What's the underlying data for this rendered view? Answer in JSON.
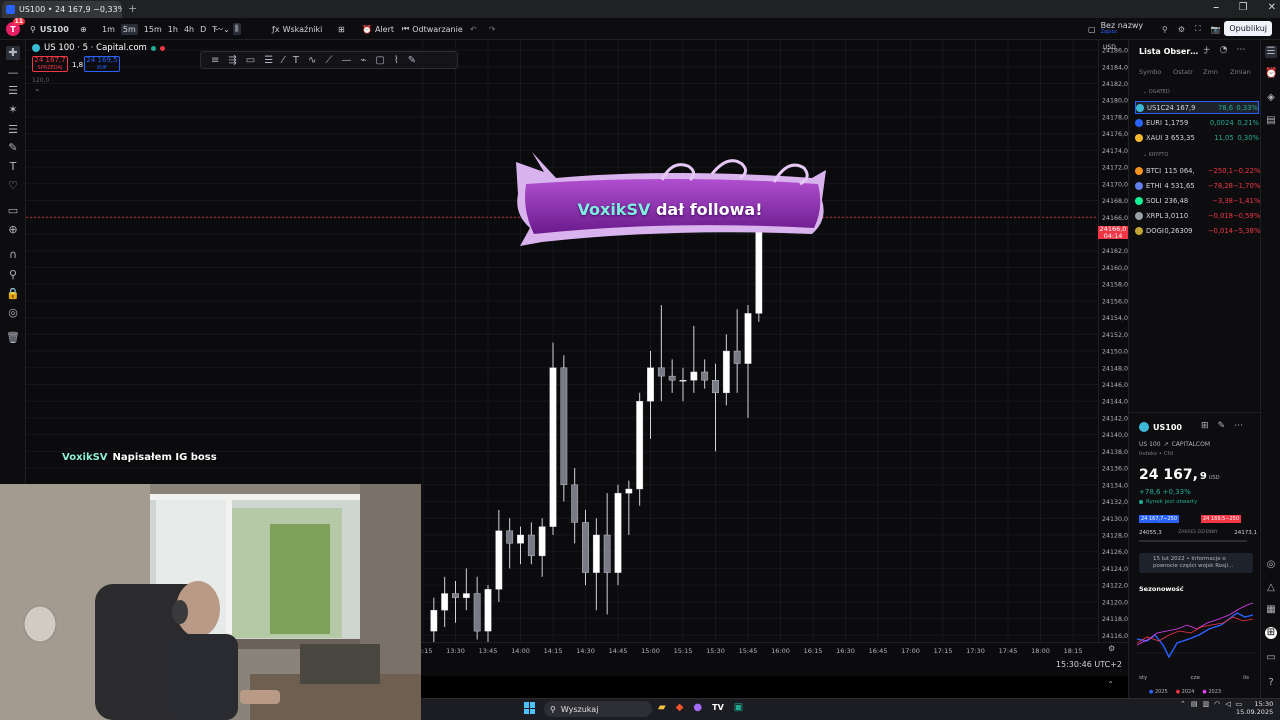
{
  "browser": {
    "tab_title": "US100 • 24 167,9 −0,33% / Bez…",
    "new_tab": "+",
    "window_controls": [
      "⎯",
      "❐",
      "✕"
    ]
  },
  "toolbar": {
    "logo_badge": "11",
    "symbol": "US100",
    "timeframes": [
      "1m",
      "5m",
      "15m",
      "1h",
      "4h",
      "D",
      "T"
    ],
    "selected_timeframe": "5m",
    "indicators_label": "Wskaźniki",
    "alert_label": "Alert",
    "replay_label": "Odtwarzanie",
    "layout_name": "Bez nazwy",
    "layout_sub": "Zapisz",
    "publish_label": "Opublikuj"
  },
  "chart": {
    "legend_title": "US 100 · 5 · Capital.com",
    "bid_price": "24 167,7",
    "bid_label": "SPRZEDAJ",
    "spread": "1,8",
    "ask_price": "24 169,5",
    "ask_label": "KUP",
    "small_label": "120,0"
  },
  "chart_data": {
    "type": "candlestick",
    "y_ticks": [
      "24186,0",
      "24184,0",
      "24182,0",
      "24180,0",
      "24178,0",
      "24176,0",
      "24174,0",
      "24172,0",
      "24170,0",
      "24168,0",
      "24166,0",
      "24164,0",
      "24162,0",
      "24160,0",
      "24158,0",
      "24156,0",
      "24154,0",
      "24152,0",
      "24150,0",
      "24148,0",
      "24146,0",
      "24144,0",
      "24142,0",
      "24140,0",
      "24138,0",
      "24136,0",
      "24134,0",
      "24132,0",
      "24130,0",
      "24128,0",
      "24126,0",
      "24124,0",
      "24122,0",
      "24120,0",
      "24118,0",
      "24116,0"
    ],
    "ylim": [
      24115.2,
      24187.2
    ],
    "x_ticks": [
      "13:15",
      "13:30",
      "13:45",
      "14:00",
      "14:15",
      "14:30",
      "14:45",
      "15:00",
      "15:15",
      "15:30",
      "15:45",
      "16:00",
      "16:15",
      "16:30",
      "16:45",
      "17:00",
      "17:15",
      "17:30",
      "17:45",
      "18:00",
      "18:15"
    ],
    "current_price": "24166,0",
    "current_price_timer": "04:14",
    "current_price_value": 24166.0,
    "currency": "USD",
    "candles": [
      {
        "o": 24116.5,
        "h": 24120.5,
        "l": 24115.0,
        "c": 24119.0
      },
      {
        "o": 24119.0,
        "h": 24123.0,
        "l": 24117.0,
        "c": 24121.0
      },
      {
        "o": 24121.0,
        "h": 24122.5,
        "l": 24117.5,
        "c": 24120.5
      },
      {
        "o": 24120.5,
        "h": 24124.0,
        "l": 24119.0,
        "c": 24121.0
      },
      {
        "o": 24121.0,
        "h": 24123.0,
        "l": 24115.5,
        "c": 24116.5
      },
      {
        "o": 24116.5,
        "h": 24122.0,
        "l": 24115.0,
        "c": 24121.5
      },
      {
        "o": 24121.5,
        "h": 24131.0,
        "l": 24120.0,
        "c": 24128.5
      },
      {
        "o": 24128.5,
        "h": 24130.0,
        "l": 24124.0,
        "c": 24127.0
      },
      {
        "o": 24127.0,
        "h": 24129.0,
        "l": 24124.5,
        "c": 24128.0
      },
      {
        "o": 24128.0,
        "h": 24129.5,
        "l": 24124.5,
        "c": 24125.5
      },
      {
        "o": 24125.5,
        "h": 24130.0,
        "l": 24123.0,
        "c": 24129.0
      },
      {
        "o": 24129.0,
        "h": 24151.0,
        "l": 24128.0,
        "c": 24148.0
      },
      {
        "o": 24148.0,
        "h": 24149.5,
        "l": 24132.0,
        "c": 24134.0
      },
      {
        "o": 24134.0,
        "h": 24136.0,
        "l": 24127.0,
        "c": 24129.5
      },
      {
        "o": 24129.5,
        "h": 24131.0,
        "l": 24122.0,
        "c": 24123.5
      },
      {
        "o": 24123.5,
        "h": 24130.0,
        "l": 24119.0,
        "c": 24128.0
      },
      {
        "o": 24128.0,
        "h": 24133.0,
        "l": 24118.5,
        "c": 24123.5
      },
      {
        "o": 24123.5,
        "h": 24134.0,
        "l": 24122.0,
        "c": 24133.0
      },
      {
        "o": 24133.0,
        "h": 24134.5,
        "l": 24128.0,
        "c": 24133.5
      },
      {
        "o": 24133.5,
        "h": 24145.0,
        "l": 24131.5,
        "c": 24144.0
      },
      {
        "o": 24144.0,
        "h": 24150.0,
        "l": 24139.5,
        "c": 24148.0
      },
      {
        "o": 24148.0,
        "h": 24155.5,
        "l": 24144.0,
        "c": 24147.0
      },
      {
        "o": 24147.0,
        "h": 24149.0,
        "l": 24145.0,
        "c": 24146.5
      },
      {
        "o": 24146.5,
        "h": 24148.0,
        "l": 24144.0,
        "c": 24146.5
      },
      {
        "o": 24146.5,
        "h": 24153.0,
        "l": 24145.0,
        "c": 24147.5
      },
      {
        "o": 24147.5,
        "h": 24149.0,
        "l": 24145.5,
        "c": 24146.5
      },
      {
        "o": 24146.5,
        "h": 24148.5,
        "l": 24138.0,
        "c": 24145.0
      },
      {
        "o": 24145.0,
        "h": 24152.0,
        "l": 24143.5,
        "c": 24150.0
      },
      {
        "o": 24150.0,
        "h": 24155.0,
        "l": 24145.0,
        "c": 24148.5
      },
      {
        "o": 24148.5,
        "h": 24155.5,
        "l": 24142.0,
        "c": 24154.5
      },
      {
        "o": 24154.5,
        "h": 24167.0,
        "l": 24153.5,
        "c": 24166.0
      }
    ],
    "up_color": "#ffffff",
    "down_color": "#787b86",
    "grid": true
  },
  "drawing_tools": [
    "≡",
    "⇶",
    "▭",
    "☰",
    "⁄",
    "T",
    "∿",
    "⟋",
    "—",
    "⌁",
    "▢",
    "⌇",
    "✎"
  ],
  "left_tools": [
    "✚",
    "—",
    "☰",
    "✶",
    "☰",
    "✎",
    "T",
    "♡",
    "▭",
    "⊕",
    "∩",
    "⚲",
    "🔒",
    "◎",
    "🗑"
  ],
  "watchlist": {
    "title": "Lista Obser…",
    "columns": [
      "Symbo",
      "Ostatr",
      "Zmn",
      "Zmian"
    ],
    "section1": "OGATED",
    "section2": "KRYPTO",
    "rows": [
      {
        "sym": "US1C",
        "last": "24 167,9",
        "chg": "78,6",
        "pct": "0,33%",
        "dir": "up",
        "color": "#3bb9d6"
      },
      {
        "sym": "EURI",
        "last": "1,1759",
        "chg": "0,0024",
        "pct": "0,21%",
        "dir": "up",
        "color": "#2962ff"
      },
      {
        "sym": "XAUI",
        "last": "3 653,35",
        "chg": "11,05",
        "pct": "0,30%",
        "dir": "up",
        "color": "#f5b82e"
      },
      {
        "sym": "BTCI",
        "last": "115 064,",
        "chg": "−250,1",
        "pct": "−0,22%",
        "dir": "dn",
        "color": "#f7931a"
      },
      {
        "sym": "ETHI",
        "last": "4 531,65",
        "chg": "−78,28",
        "pct": "−1,70%",
        "dir": "dn",
        "color": "#627eea"
      },
      {
        "sym": "SOLI",
        "last": "236,48",
        "chg": "−3,38",
        "pct": "−1,41%",
        "dir": "dn",
        "color": "#14f195"
      },
      {
        "sym": "XRPL",
        "last": "3,0110",
        "chg": "−0,018",
        "pct": "−0,59%",
        "dir": "dn",
        "color": "#9aa0a6"
      },
      {
        "sym": "DOGI",
        "last": "0,26309",
        "chg": "−0,014",
        "pct": "−5,38%",
        "dir": "dn",
        "color": "#c2a633"
      }
    ]
  },
  "details": {
    "symbol": "US100",
    "name": "US 100",
    "exchange": "CAPITALCOM",
    "type": "Indeks • Cfd",
    "price_main": "24 167,",
    "price_last": "9",
    "currency": "USD",
    "change": "+78,6 +0,33%",
    "market_status": "Rynek jest otwarty",
    "bid": "24 167,7−250",
    "ask": "24 169,5−250",
    "range_low": "24055,3",
    "range_label": "ZAKRES DZIENNY",
    "range_high": "24173,1",
    "news_date": "15 lut 2022",
    "news_text": "Informacje o powrocie części wojsk Rosji…",
    "seasonal_title": "Sezonowość",
    "seasonal_x": [
      "sty",
      "cze",
      "lis"
    ],
    "seasonal_legend": [
      "2025",
      "2024",
      "2023"
    ]
  },
  "right_strip": [
    "☰",
    "⏰",
    "◈",
    "▤",
    "◎",
    "△",
    "▦",
    "⊞",
    "▭",
    "?"
  ],
  "bottom": {
    "time_label": "15:30:46 UTC+2"
  },
  "overlay": {
    "banner_user": "VoxikSV",
    "banner_text": "dał followa!",
    "chat_user": "VoxikSV",
    "chat_message": "Napisałem IG boss"
  },
  "taskbar": {
    "search_label": "Wyszukaj",
    "time": "15:30",
    "date": "15.09.2025"
  }
}
